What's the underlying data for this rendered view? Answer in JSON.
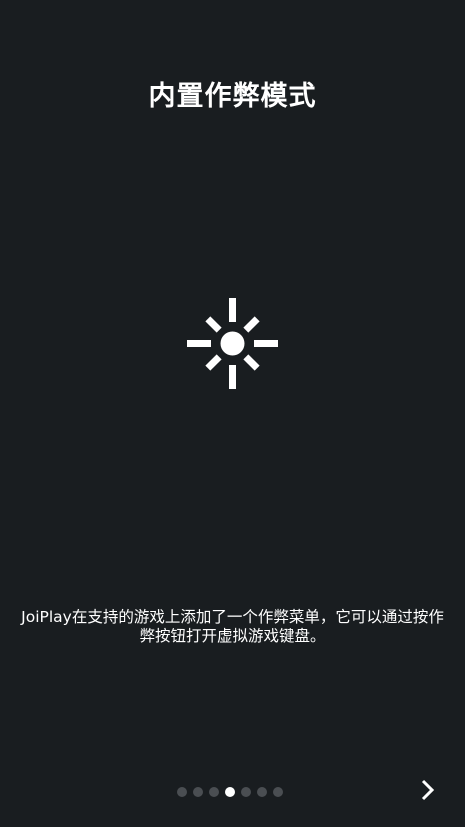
{
  "onboarding": {
    "title": "内置作弊模式",
    "icon": "brightness-icon",
    "description": "JoiPlay在支持的游戏上添加了一个作弊菜单，它可以通过按作弊按钮打开虚拟游戏键盘。",
    "pager": {
      "total": 7,
      "current_index": 3
    },
    "next_icon": "chevron-right-icon"
  },
  "colors": {
    "background": "#191d20",
    "text": "#ffffff",
    "dot_inactive": "#4a4e52",
    "dot_active": "#ffffff"
  }
}
